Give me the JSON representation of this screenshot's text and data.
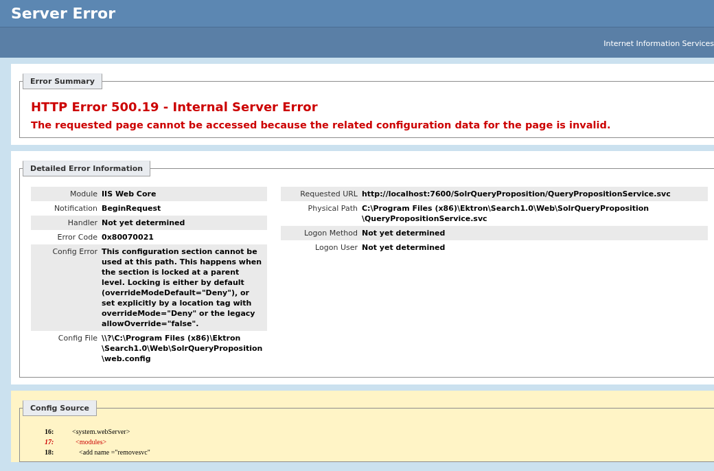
{
  "header": {
    "title": "Server Error",
    "subtitle": "Internet Information Services"
  },
  "error_summary": {
    "legend": "Error Summary",
    "heading": "HTTP Error 500.19 - Internal Server Error",
    "message": "The requested page cannot be accessed because the related configuration data for the page is invalid."
  },
  "detailed_error": {
    "legend": "Detailed Error Information",
    "left_table": [
      {
        "label": "Module",
        "value": "IIS Web Core"
      },
      {
        "label": "Notification",
        "value": "BeginRequest"
      },
      {
        "label": "Handler",
        "value": "Not yet determined"
      },
      {
        "label": "Error Code",
        "value": "0x80070021"
      },
      {
        "label": "Config Error",
        "value": "This configuration section cannot be used at this path. This happens when the section is locked at a parent level. Locking is either by default (overrideModeDefault=\"Deny\"), or set explicitly by a location tag with overrideMode=\"Deny\" or the legacy allowOverride=\"false\"."
      },
      {
        "label": "Config File",
        "value": "\\\\?\\C:\\Program Files (x86)\\Ektron\\Search1.0\\Web\\SolrQueryProposition\\web.config"
      }
    ],
    "right_table": [
      {
        "label": "Requested URL",
        "value": "http://localhost:7600/SolrQueryProposition/QueryPropositionService.svc"
      },
      {
        "label": "Physical Path",
        "value": "C:\\Program Files (x86)\\Ektron\\Search1.0\\Web\\SolrQueryProposition\\QueryPropositionService.svc"
      },
      {
        "label": "Logon Method",
        "value": "Not yet determined"
      },
      {
        "label": "Logon User",
        "value": "Not yet determined"
      }
    ]
  },
  "config_source": {
    "legend": "Config Source",
    "lines": [
      {
        "number": "16:",
        "code": "<system.webServer>",
        "highlighted": false
      },
      {
        "number": "17:",
        "code": "  <modules>",
        "highlighted": true
      },
      {
        "number": "18:",
        "code": "    <add name =\"removesvc\"",
        "highlighted": false
      }
    ]
  }
}
